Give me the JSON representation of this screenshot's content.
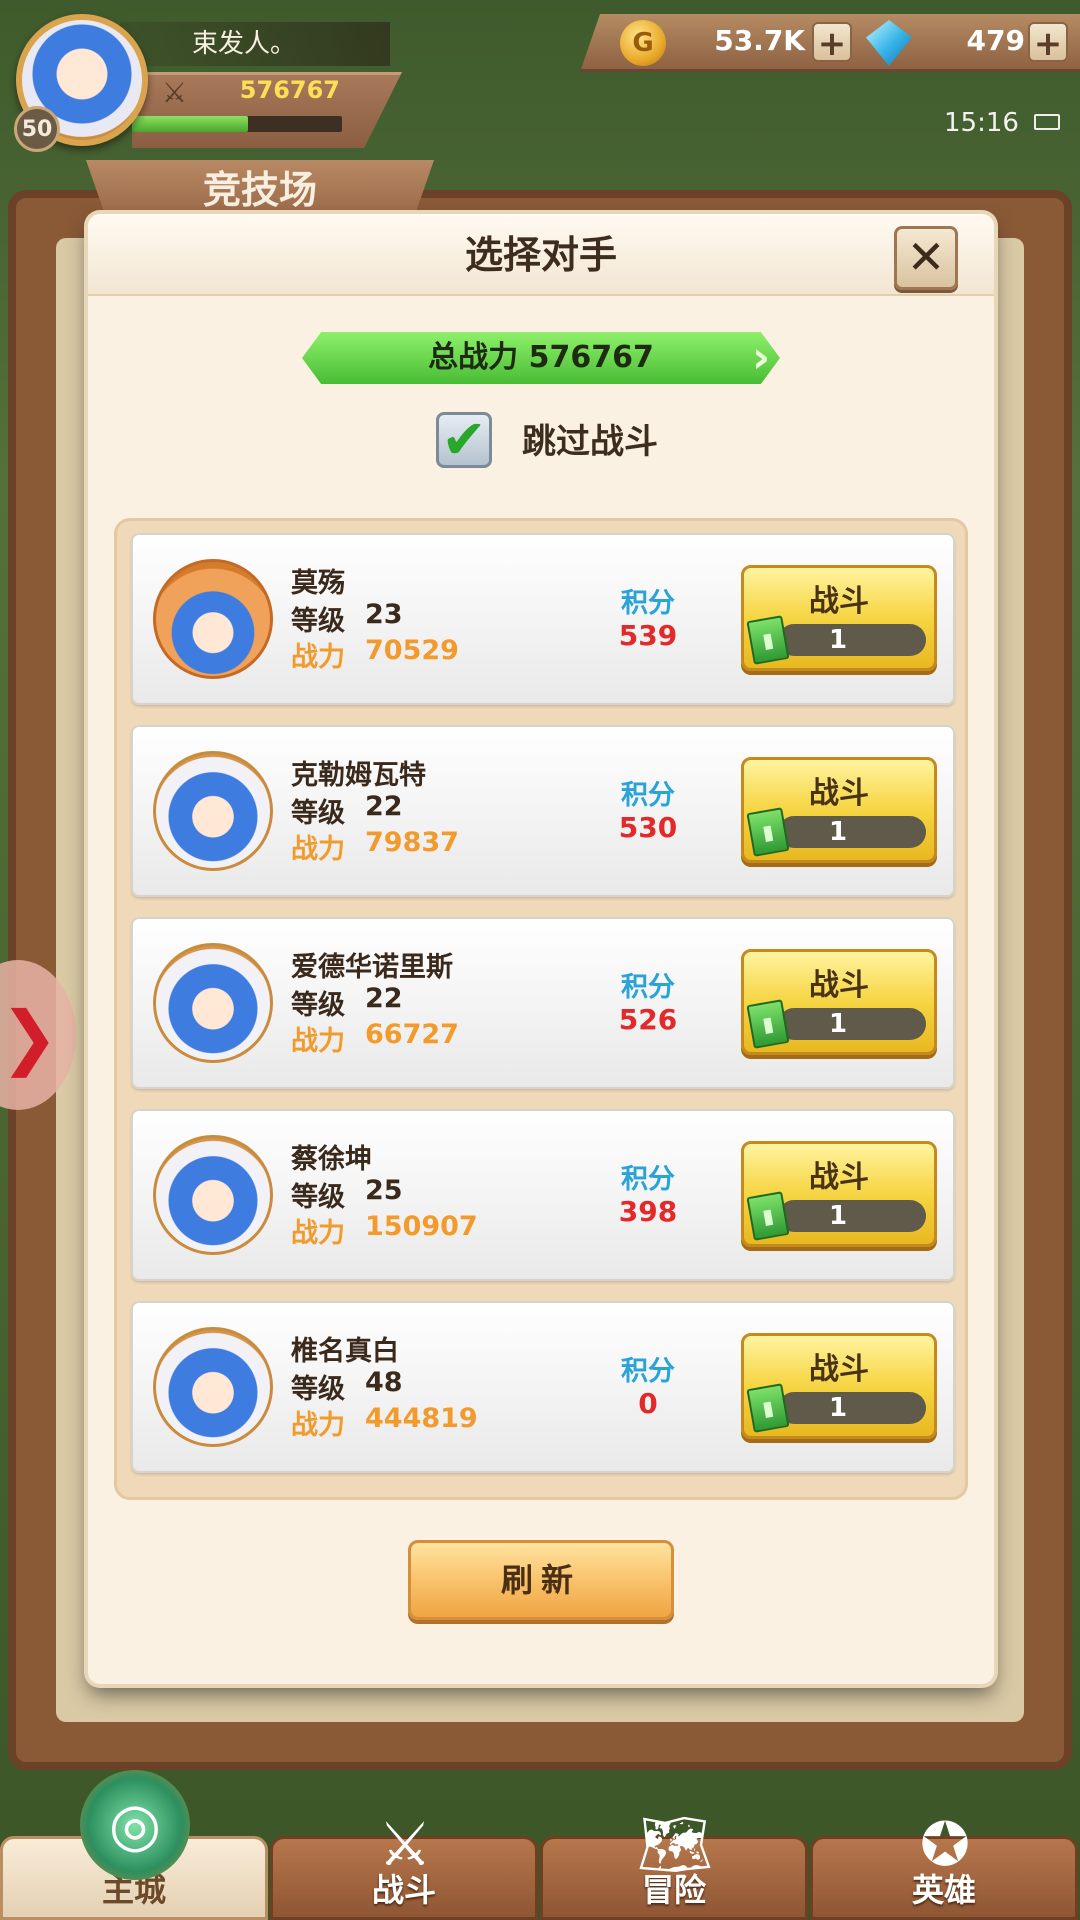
{
  "player": {
    "name": "束发人。",
    "level": "50",
    "power": "576767",
    "xp_fraction": 0.55
  },
  "resources": {
    "gold": "53.7K",
    "gems": "479",
    "plus": "+"
  },
  "status": {
    "time": "15:16"
  },
  "background": {
    "arena_title": "竞技场"
  },
  "modal": {
    "title": "选择对手",
    "close_symbol": "✕",
    "total_power_label": "总战力",
    "total_power_value": "576767",
    "skip_label": "跳过战斗",
    "skip_checked": true,
    "refresh_label": "刷新"
  },
  "labels": {
    "level": "等级",
    "power": "战力",
    "score": "积分",
    "fight": "战斗"
  },
  "opponents": [
    {
      "name": "莫殇",
      "level": "23",
      "power": "70529",
      "score": "539",
      "cost": "1",
      "avatar": "shiba-hat-avatar"
    },
    {
      "name": "克勒姆瓦特",
      "level": "22",
      "power": "79837",
      "score": "530",
      "cost": "1",
      "avatar": "hero-avatar"
    },
    {
      "name": "爱德华诺里斯",
      "level": "22",
      "power": "66727",
      "score": "526",
      "cost": "1",
      "avatar": "hero-avatar"
    },
    {
      "name": "蔡徐坤",
      "level": "25",
      "power": "150907",
      "score": "398",
      "cost": "1",
      "avatar": "hero-avatar"
    },
    {
      "name": "椎名真白",
      "level": "48",
      "power": "444819",
      "score": "0",
      "cost": "1",
      "avatar": "hero-avatar"
    }
  ],
  "nav": [
    {
      "label": "主城",
      "icon": "castle-icon",
      "active": true
    },
    {
      "label": "战斗",
      "icon": "crossed-swords-icon",
      "active": false
    },
    {
      "label": "冒险",
      "icon": "adventure-map-icon",
      "active": false
    },
    {
      "label": "英雄",
      "icon": "hero-crest-icon",
      "active": false
    }
  ],
  "colors": {
    "score_label": "#2aa3d5",
    "score_value": "#e22a2a",
    "power": "#f29a2b",
    "accent_green": "#48bd34",
    "fight_gold": "#f7d84a"
  }
}
